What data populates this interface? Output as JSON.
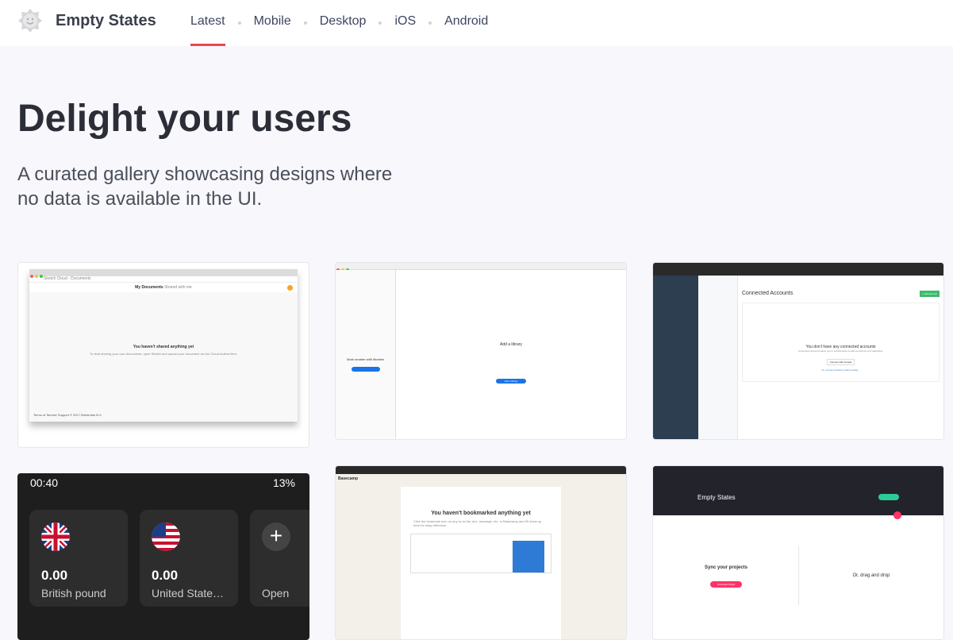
{
  "header": {
    "brand": "Empty States",
    "logo_icon": "smiley-sun-icon",
    "nav": [
      {
        "label": "Latest",
        "active": true
      },
      {
        "label": "Mobile"
      },
      {
        "label": "Desktop"
      },
      {
        "label": "iOS"
      },
      {
        "label": "Android"
      }
    ],
    "accent": "#e8474f"
  },
  "hero": {
    "title": "Delight your users",
    "subtitle": "A curated gallery showcasing designs where no data is available in the UI."
  },
  "cards": [
    {
      "tab": "Sketch Cloud - Documents",
      "nav_active": "My Documents",
      "nav_other": "Shared with me",
      "heading": "You haven't shared anything yet",
      "body": "To start sharing your own documents, open Sketch and upload your document via the Cloud toolbar item.",
      "footer": "Terms of Service   Support   © 2017 Bohemian B.V."
    },
    {
      "heading": "Add a library",
      "left_heading": "Work smarter with libraries",
      "button": "Add a library"
    },
    {
      "title": "Connected Accounts",
      "button": "+ Add account",
      "heading": "You don't have any connected accounts",
      "sub": "Connected accounts allow you to send/receive emails as well as sync calendars.",
      "connect": "Connect with Google",
      "link": "Or, connect another email provider..."
    },
    {
      "time": "00:40",
      "battery": "13%",
      "currencies": [
        {
          "amount": "0.00",
          "name": "British pound"
        },
        {
          "amount": "0.00",
          "name": "United State…"
        }
      ],
      "open_label": "Open"
    },
    {
      "brand": "Basecamp",
      "heading": "You haven't bookmarked anything yet",
      "body": "Click the bookmark icon on any to-do list, doc, message, etc. in Basecamp and it'll show up here for easy reference."
    },
    {
      "title": "Empty States",
      "sync": "Sync your projects",
      "drag": "Or, drag and drop",
      "button": "Download Plugin"
    }
  ]
}
